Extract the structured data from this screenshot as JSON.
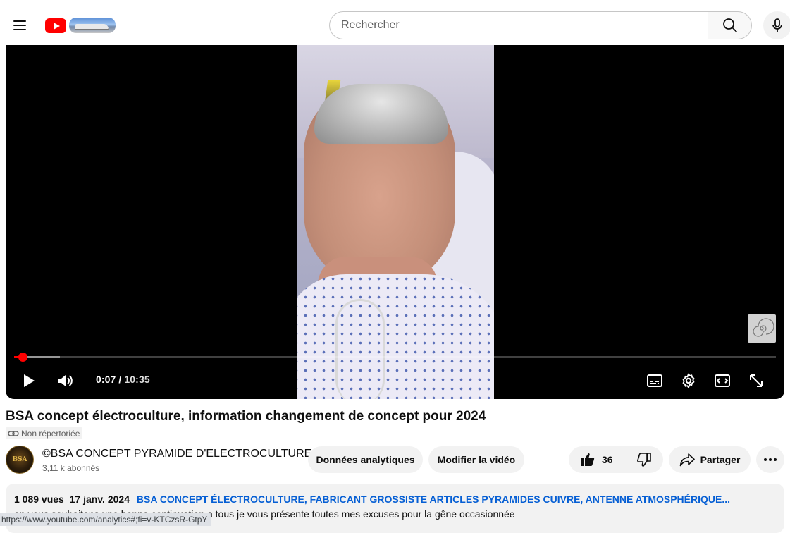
{
  "header": {
    "search_placeholder": "Rechercher"
  },
  "player": {
    "current_time": "0:07",
    "duration": "10:35",
    "played_fraction": 0.011,
    "buffered_fraction": 0.06
  },
  "video": {
    "title": "BSA concept électroculture, information changement de concept pour 2024",
    "visibility_badge": "Non répertoriée"
  },
  "channel": {
    "avatar_text": "BSA",
    "name": "©BSA CONCEPT PYRAMIDE D'ELECTROCULTURE",
    "subscribers": "3,11 k abonnés"
  },
  "actions": {
    "analytics_label": "Données analytiques",
    "edit_label": "Modifier la vidéo",
    "like_count": "36",
    "share_label": "Partager"
  },
  "description": {
    "views": "1 089 vues",
    "date": "17 janv. 2024",
    "tags": "BSA CONCEPT ÉLECTROCULTURE, FABRICANT GROSSISTE ARTICLES PYRAMIDES CUIVRE, ANTENNE ATMOSPHÉRIQUE...",
    "text": "on vous souhaitons une bonne continuation a tous je vous présente toutes mes excuses pour la gêne occasionnée"
  },
  "status_bar": {
    "url": "https://www.youtube.com/analytics#;fi=v-KTCzsR-GtpY"
  },
  "colors": {
    "brand_red": "#ff0000",
    "link_blue": "#065fd4",
    "chip_bg": "#f2f2f2"
  },
  "icons": [
    "menu-icon",
    "youtube-logo",
    "search-icon",
    "mic-icon",
    "play-icon",
    "volume-icon",
    "subtitles-icon",
    "settings-icon",
    "theater-mode-icon",
    "fullscreen-icon",
    "link-icon",
    "thumbs-up-icon",
    "thumbs-down-icon",
    "share-icon",
    "more-icon"
  ]
}
